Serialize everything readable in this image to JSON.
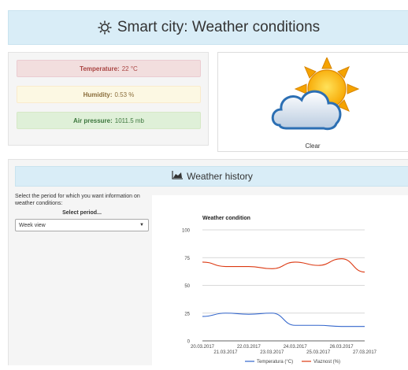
{
  "header": {
    "title": "Smart city: Weather conditions"
  },
  "metrics": {
    "temperature": {
      "label": "Temperature:",
      "value": "22 °C"
    },
    "humidity": {
      "label": "Humidity:",
      "value": "0.53 %"
    },
    "air_pressure": {
      "label": "Air pressure:",
      "value": "1011.5 mb"
    }
  },
  "current": {
    "condition": "Clear",
    "icon": "sun-behind-cloud-icon"
  },
  "history": {
    "title": "Weather history",
    "prompt": "Select the period for which you want information on weather conditions:",
    "select_label": "Select period...",
    "select_value": "Week view"
  },
  "colors": {
    "temperature": "#3366cc",
    "humidity": "#dc3912",
    "panel_blue": "#d9edf7"
  },
  "chart_data": {
    "type": "line",
    "title": "Weather condition",
    "x": [
      "20.03.2017",
      "21.03.2017",
      "22.03.2017",
      "23.03.2017",
      "24.03.2017",
      "25.03.2017",
      "26.03.2017",
      "27.03.2017"
    ],
    "ylim": [
      0,
      100
    ],
    "yticks": [
      0,
      25,
      50,
      75,
      100
    ],
    "grid": true,
    "legend_position": "bottom",
    "series": [
      {
        "name": "Temperatura (°C)",
        "color": "#3366cc",
        "values": [
          22,
          25,
          24,
          25,
          14,
          14,
          13,
          13
        ]
      },
      {
        "name": "Vlaznost (%)",
        "color": "#dc3912",
        "values": [
          71,
          67,
          67,
          65,
          71,
          68,
          74,
          62
        ]
      }
    ]
  }
}
